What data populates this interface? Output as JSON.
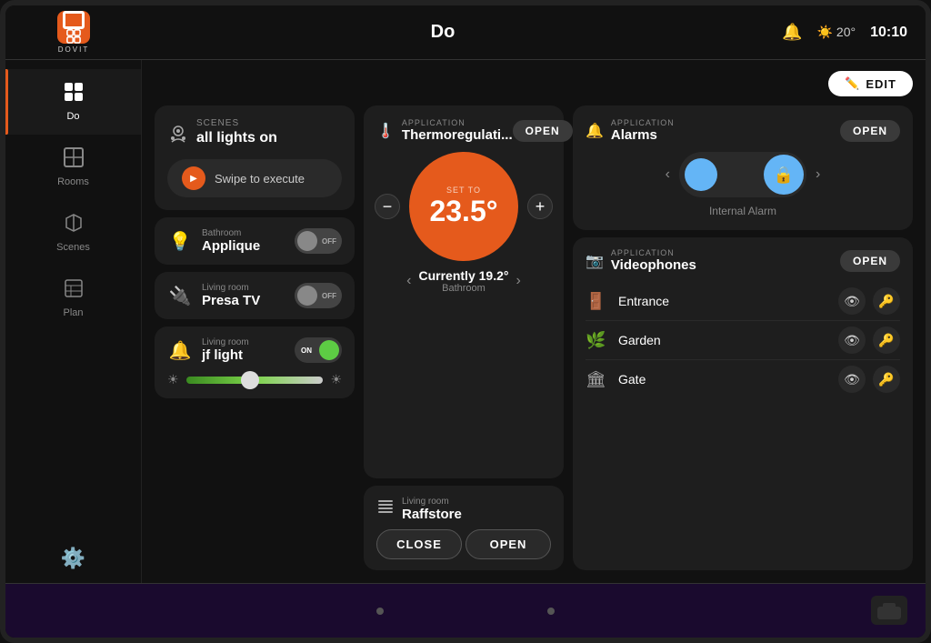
{
  "topbar": {
    "title": "Do",
    "temp": "20°",
    "time": "10:10",
    "edit_label": "EDIT"
  },
  "sidebar": {
    "items": [
      {
        "id": "do",
        "label": "Do",
        "icon": "⊞",
        "active": true
      },
      {
        "id": "rooms",
        "label": "Rooms",
        "icon": "⊟"
      },
      {
        "id": "scenes",
        "label": "Scenes",
        "icon": "⌂"
      },
      {
        "id": "plan",
        "label": "Plan",
        "icon": "⊡"
      },
      {
        "id": "settings",
        "label": "",
        "icon": "⚙"
      }
    ]
  },
  "scenes_card": {
    "subtitle": "Scenes",
    "title": "all lights on",
    "swipe_label": "Swipe to execute"
  },
  "devices": [
    {
      "room": "Bathroom",
      "name": "Applique",
      "state": "OFF"
    },
    {
      "room": "Living room",
      "name": "Presa TV",
      "state": "OFF"
    },
    {
      "room": "Living room",
      "name": "jf light",
      "state": "ON"
    }
  ],
  "thermo": {
    "app_tag": "Application",
    "app_name": "Thermoregulati...",
    "open_label": "OPEN",
    "set_label": "SET TO",
    "set_temp": "23.5°",
    "current_label": "Currently 19.2°",
    "current_room": "Bathroom"
  },
  "raffstore": {
    "room": "Living room",
    "name": "Raffstore",
    "close_label": "CLOSE",
    "open_label": "OPEN"
  },
  "alarm": {
    "app_tag": "Application",
    "app_name": "Alarms",
    "open_label": "OPEN",
    "alarm_label": "Internal Alarm"
  },
  "videophones": {
    "app_tag": "Application",
    "app_name": "Videophones",
    "open_label": "OPEN",
    "items": [
      {
        "name": "Entrance"
      },
      {
        "name": "Garden"
      },
      {
        "name": "Gate"
      }
    ]
  }
}
